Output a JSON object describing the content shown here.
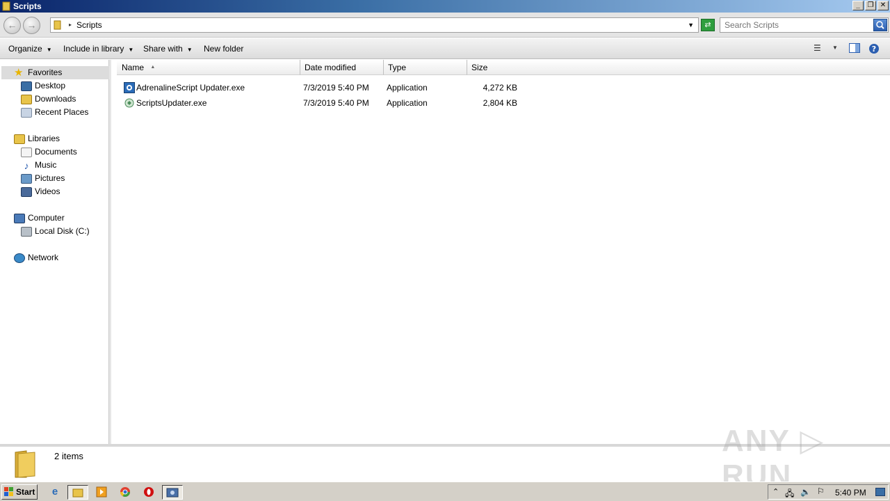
{
  "window": {
    "title": "Scripts",
    "buttons": [
      "minimize",
      "restore",
      "close"
    ]
  },
  "address_bar": {
    "path": "Scripts",
    "search_placeholder": "Search Scripts"
  },
  "toolbar": {
    "organize": "Organize",
    "include_in_library": "Include in library",
    "share_with": "Share with",
    "new_folder": "New folder"
  },
  "nav": {
    "favorites": "Favorites",
    "desktop": "Desktop",
    "downloads": "Downloads",
    "recent_places": "Recent Places",
    "libraries": "Libraries",
    "documents": "Documents",
    "music": "Music",
    "pictures": "Pictures",
    "videos": "Videos",
    "computer": "Computer",
    "local_disk": "Local Disk (C:)",
    "network": "Network"
  },
  "columns": {
    "name": "Name",
    "date_modified": "Date modified",
    "type": "Type",
    "size": "Size"
  },
  "files": [
    {
      "name": "AdrenalineScript Updater.exe",
      "date": "7/3/2019 5:40 PM",
      "type": "Application",
      "size": "4,272 KB"
    },
    {
      "name": "ScriptsUpdater.exe",
      "date": "7/3/2019 5:40 PM",
      "type": "Application",
      "size": "2,804 KB"
    }
  ],
  "details": {
    "count": "2 items"
  },
  "watermark": "ANY RUN",
  "taskbar": {
    "start": "Start",
    "clock": "5:40 PM"
  },
  "colors": {
    "title_gradient_start": "#0a246a",
    "title_gradient_end": "#a6caf0",
    "taskbar": "#d4d0c8"
  }
}
